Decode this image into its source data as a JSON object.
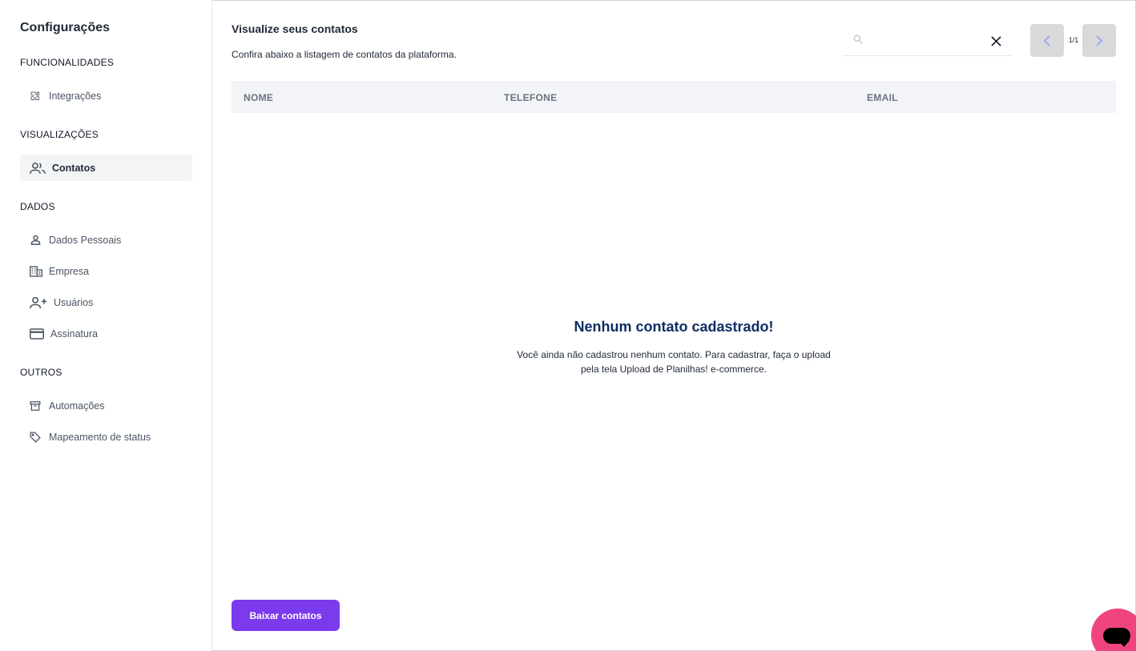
{
  "sidebar": {
    "title": "Configurações",
    "sections": [
      {
        "label": "FUNCIONALIDADES",
        "items": [
          {
            "label": "Integrações",
            "icon": "puzzle-icon"
          }
        ]
      },
      {
        "label": "VISUALIZAÇÕES",
        "items": [
          {
            "label": "Contatos",
            "icon": "contacts-icon",
            "active": true
          }
        ]
      },
      {
        "label": "DADOS",
        "items": [
          {
            "label": "Dados Pessoais",
            "icon": "user-icon"
          },
          {
            "label": "Empresa",
            "icon": "building-icon"
          },
          {
            "label": "Usuários",
            "icon": "add-user-icon"
          },
          {
            "label": "Assinatura",
            "icon": "credit-card-icon"
          }
        ]
      },
      {
        "label": "OUTROS",
        "items": [
          {
            "label": "Automações",
            "icon": "archive-icon"
          },
          {
            "label": "Mapeamento de status",
            "icon": "tag-icon"
          }
        ]
      }
    ]
  },
  "main": {
    "title": "Visualize seus contatos",
    "subtitle": "Confira abaixo a listagem de contatos da plataforma.",
    "search": {
      "value": "",
      "placeholder": ""
    },
    "pagination": {
      "label": "1/1"
    },
    "table": {
      "columns": [
        "NOME",
        "TELEFONE",
        "EMAIL"
      ]
    },
    "empty": {
      "title": "Nenhum contato cadastrado!",
      "text": "Você ainda não cadastrou nenhum contato. Para cadastrar, faça o upload pela tela Upload de Planilhas! e-commerce."
    },
    "download_label": "Baixar contatos"
  },
  "colors": {
    "accent": "#7c3aed",
    "empty_title": "#0f2e63",
    "chat": "#f0457c"
  }
}
